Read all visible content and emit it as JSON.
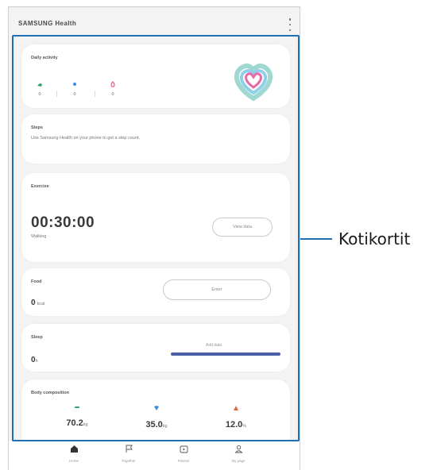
{
  "app": {
    "title": "SAMSUNG Health"
  },
  "cards": {
    "daily_activity": {
      "title": "Daily activity",
      "steps": "0",
      "active_time": "0",
      "calories": "0"
    },
    "steps": {
      "title": "Steps",
      "description": "Use Samsung Health on your phone to get a step count."
    },
    "exercise": {
      "title": "Exercise",
      "time": "00:30:00",
      "subtitle": "Walking",
      "button": "View data"
    },
    "food": {
      "title": "Food",
      "value": "0",
      "unit": "kcal",
      "button": "Enter"
    },
    "sleep": {
      "title": "Sleep",
      "value": "0",
      "unit": "h",
      "goal_text": "Add data"
    },
    "body_composition": {
      "title": "Body composition",
      "items": [
        {
          "value": "70.2",
          "unit": "kg",
          "color": "#2aa36b"
        },
        {
          "value": "35.0",
          "unit": "kg",
          "color": "#3a8de0"
        },
        {
          "value": "12.0",
          "unit": "%",
          "color": "#e06a3a"
        }
      ]
    }
  },
  "nav": [
    {
      "icon": "home-icon",
      "label": "Home"
    },
    {
      "icon": "flag-icon",
      "label": "Together"
    },
    {
      "icon": "play-icon",
      "label": "Fitness"
    },
    {
      "icon": "person-icon",
      "label": "My page"
    }
  ],
  "callout": {
    "label": "Kotikortit"
  },
  "colors": {
    "accent": "#1f6fb5",
    "sleep_bar": "#4a5fa8",
    "heart_outer": "#9fd8d2",
    "heart_inner": "#e86aa5"
  }
}
